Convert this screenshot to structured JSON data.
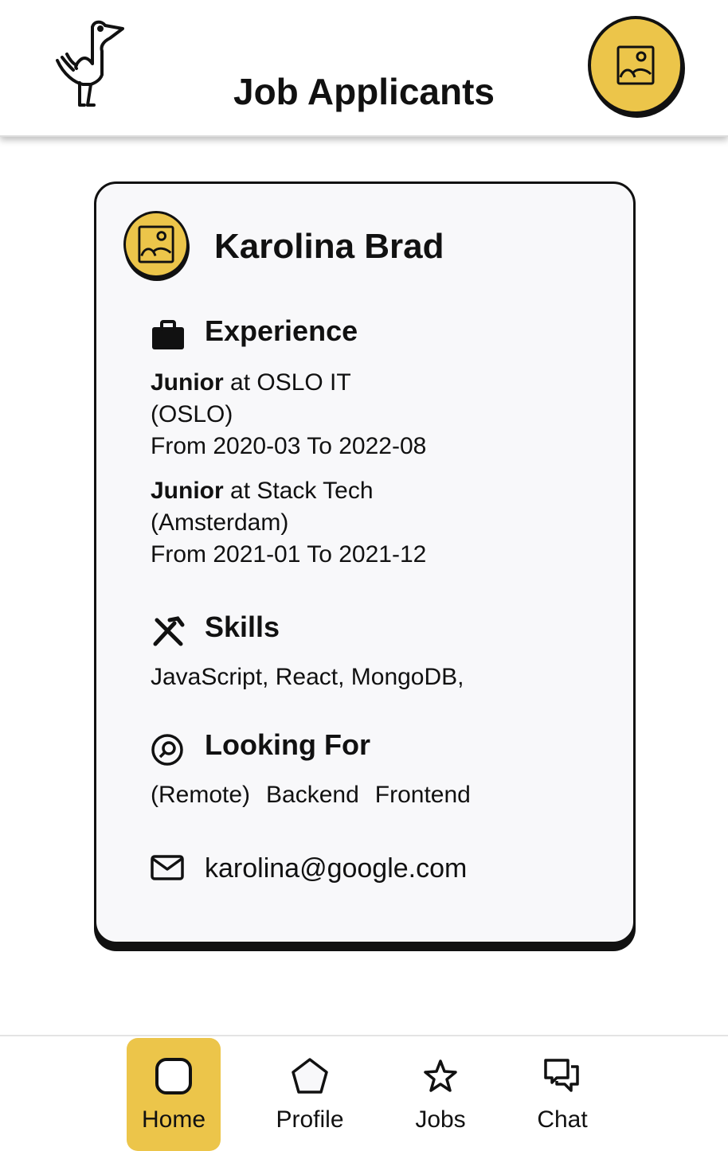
{
  "header": {
    "title": "Job Applicants"
  },
  "applicant": {
    "name": "Karolina Brad",
    "experience_title": "Experience",
    "experience": [
      {
        "role": "Junior",
        "company": " at OSLO IT",
        "location": "(OSLO)",
        "period": "From 2020-03 To 2022-08"
      },
      {
        "role": "Junior",
        "company": " at Stack Tech",
        "location": "(Amsterdam)",
        "period": "From 2021-01 To 2021-12"
      }
    ],
    "skills_title": "Skills",
    "skills": "JavaScript, React, MongoDB,",
    "looking_for_title": "Looking For",
    "looking_for": [
      "(Remote)",
      "Backend",
      "Frontend"
    ],
    "email": "karolina@google.com"
  },
  "nav": {
    "items": [
      {
        "label": "Home"
      },
      {
        "label": "Profile"
      },
      {
        "label": "Jobs"
      },
      {
        "label": "Chat"
      }
    ]
  },
  "colors": {
    "accent": "#ecc54a"
  }
}
